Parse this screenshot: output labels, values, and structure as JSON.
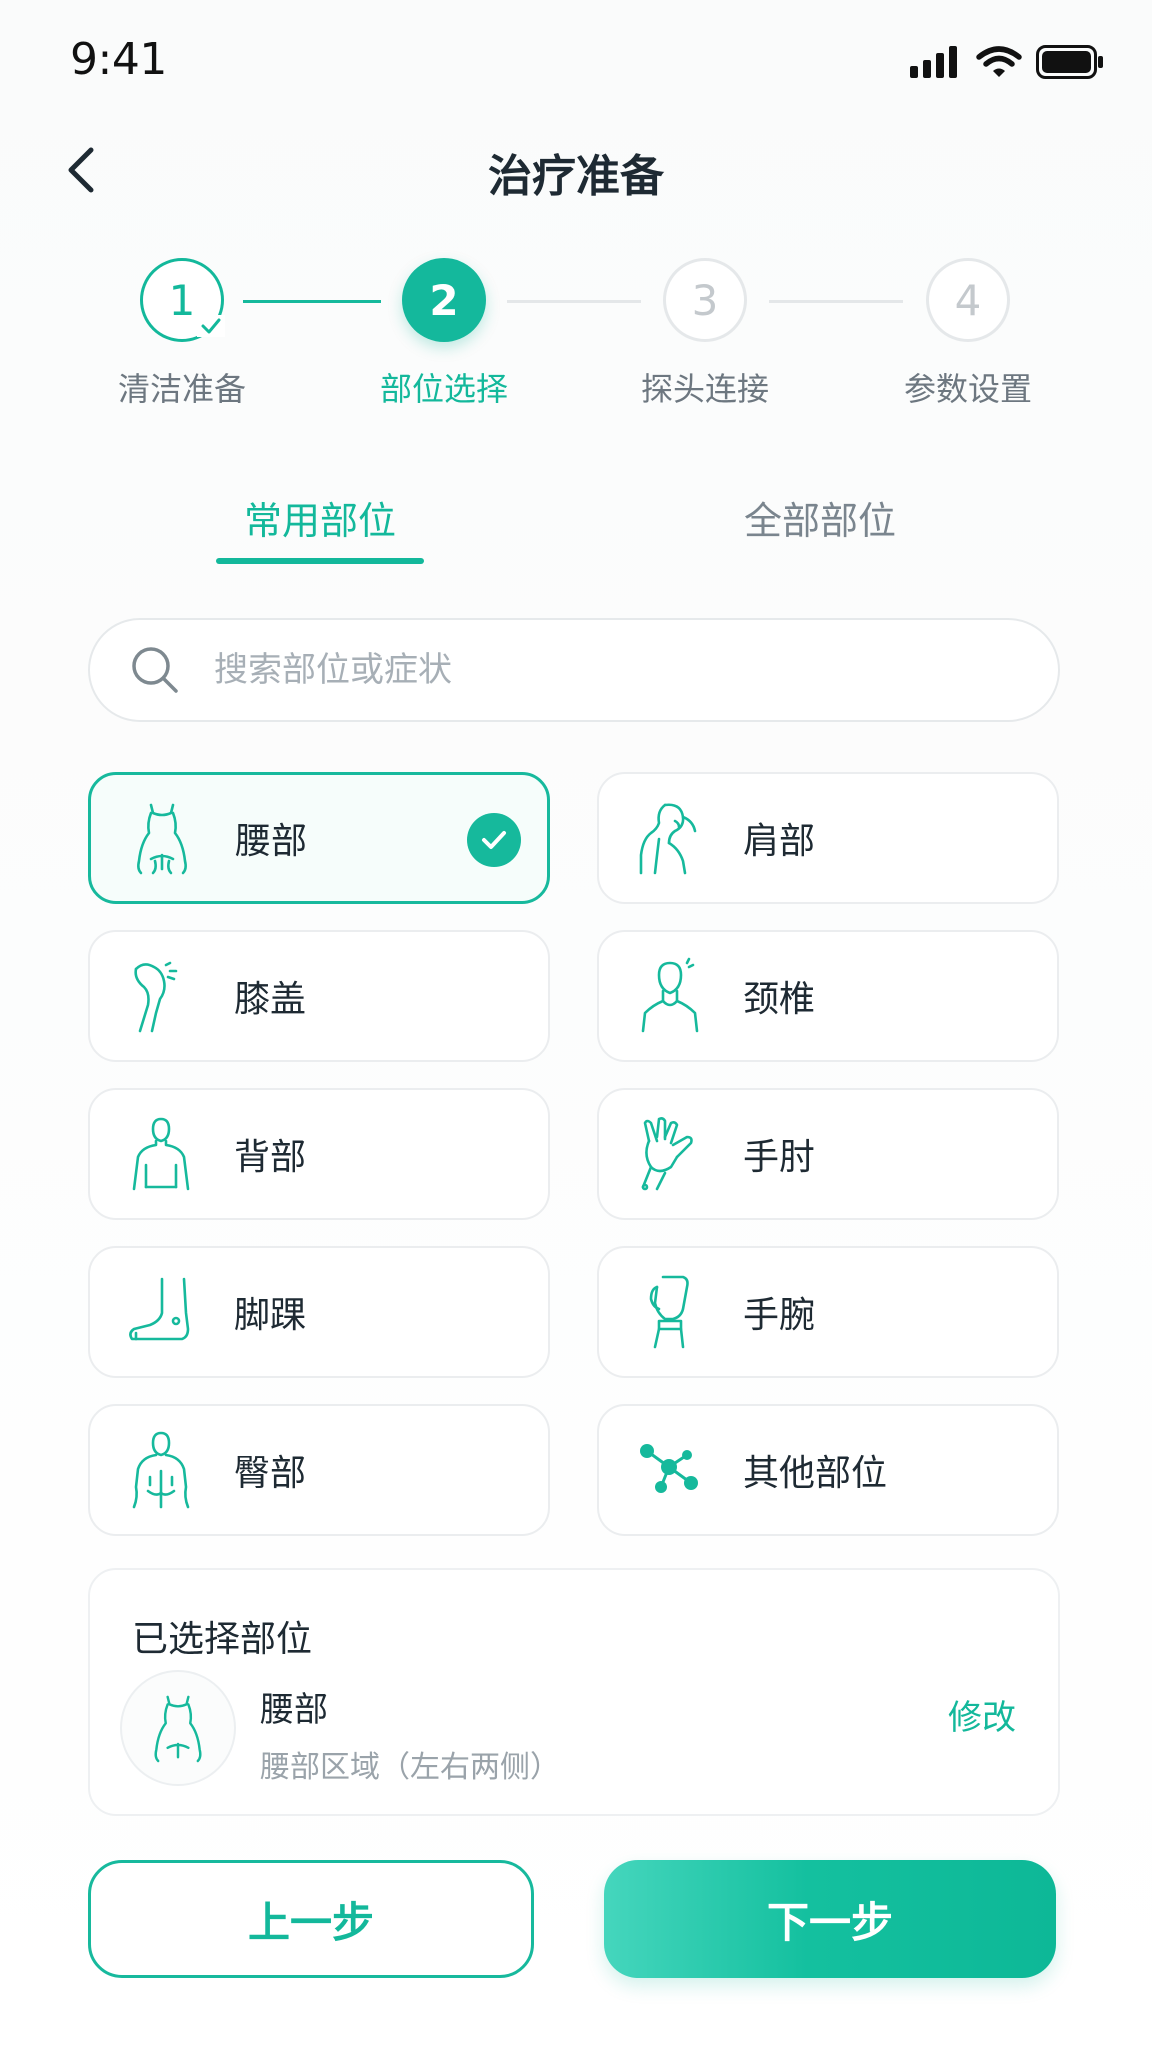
{
  "status_bar": {
    "time": "9:41"
  },
  "header": {
    "title": "治疗准备"
  },
  "stepper": {
    "steps": [
      {
        "number": "1",
        "label": "清洁准备",
        "state": "done"
      },
      {
        "number": "2",
        "label": "部位选择",
        "state": "active"
      },
      {
        "number": "3",
        "label": "探头连接",
        "state": "todo"
      },
      {
        "number": "4",
        "label": "参数设置",
        "state": "todo"
      }
    ]
  },
  "tabs": {
    "active": "常用部位",
    "inactive": "全部部位"
  },
  "search": {
    "placeholder": "搜索部位或症状",
    "value": ""
  },
  "parts": [
    {
      "label": "腰部",
      "icon": "lower-back-icon",
      "selected": true
    },
    {
      "label": "肩部",
      "icon": "shoulder-icon",
      "selected": false
    },
    {
      "label": "膝盖",
      "icon": "knee-icon",
      "selected": false
    },
    {
      "label": "颈椎",
      "icon": "neck-icon",
      "selected": false
    },
    {
      "label": "背部",
      "icon": "back-icon",
      "selected": false
    },
    {
      "label": "手肘",
      "icon": "elbow-icon",
      "selected": false
    },
    {
      "label": "脚踝",
      "icon": "ankle-icon",
      "selected": false
    },
    {
      "label": "手腕",
      "icon": "wrist-icon",
      "selected": false
    },
    {
      "label": "臀部",
      "icon": "hip-icon",
      "selected": false
    },
    {
      "label": "其他部位",
      "icon": "other-parts-icon",
      "selected": false
    }
  ],
  "selected_summary": {
    "title": "已选择部位",
    "name": "腰部",
    "description": "腰部区域（左右两侧）",
    "edit_label": "修改"
  },
  "buttons": {
    "prev_label": "上一步",
    "next_label": "下一步"
  },
  "colors": {
    "accent": "#13b89b",
    "muted_text": "#7a858e",
    "border": "#ebedef"
  }
}
